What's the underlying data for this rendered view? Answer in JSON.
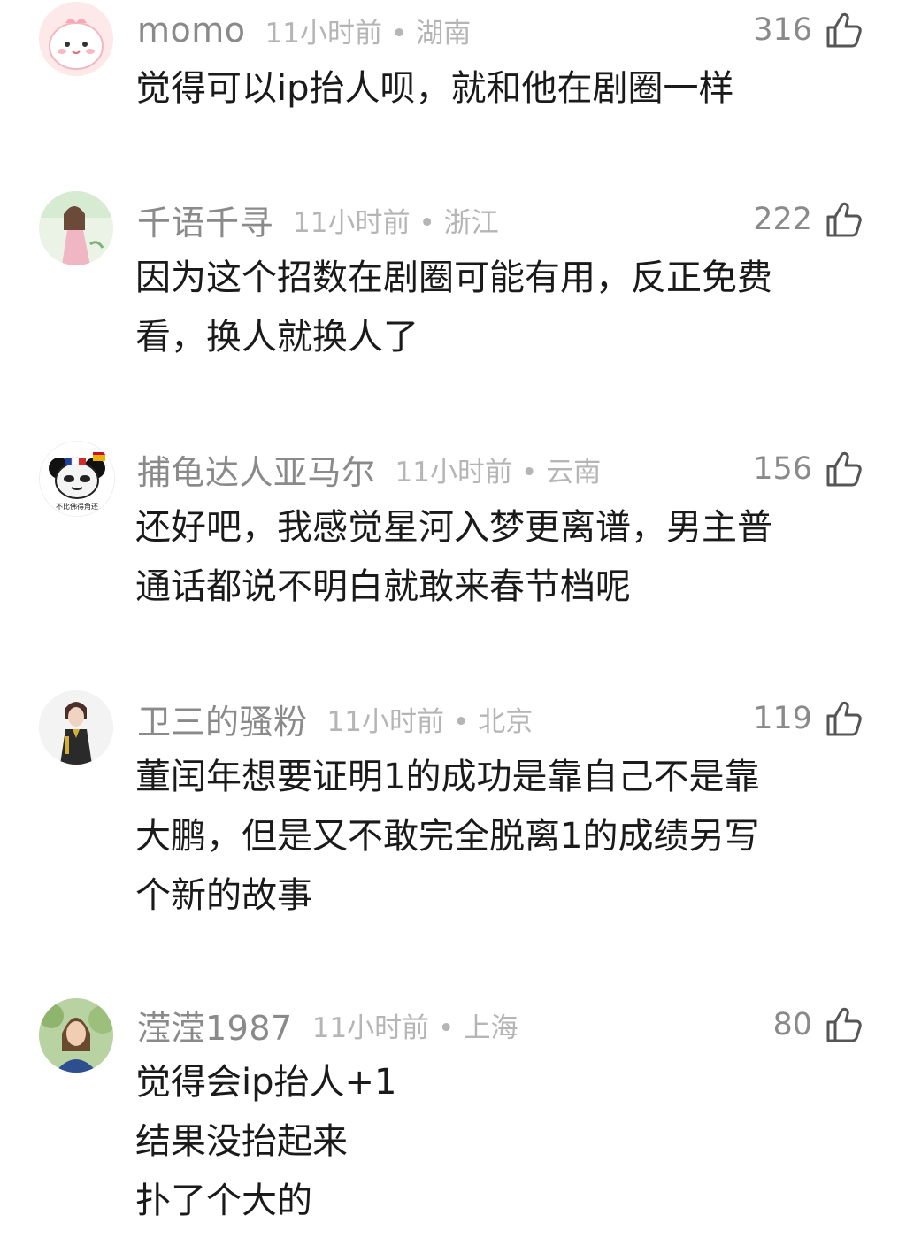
{
  "comments": [
    {
      "username": "momo",
      "time": "11小时前",
      "location": "湖南",
      "likes": "316",
      "text": "觉得可以ip抬人呗，就和他在剧圈一样",
      "avatar_icon": "pink-cartoon-avatar"
    },
    {
      "username": "千语千寻",
      "time": "11小时前",
      "location": "浙江",
      "likes": "222",
      "text": "因为这个招数在剧圈可能有用，反正免费\n看，换人就换人了",
      "avatar_icon": "illustrated-girl-avatar"
    },
    {
      "username": "捕龟达人亚马尔",
      "time": "11小时前",
      "location": "云南",
      "likes": "156",
      "text": "还好吧，我感觉星河入梦更离谱，男主普\n通话都说不明白就敢来春节档呢",
      "avatar_icon": "panda-meme-avatar",
      "avatar_caption": "不比佛得角还"
    },
    {
      "username": "卫三的骚粉",
      "time": "11小时前",
      "location": "北京",
      "likes": "119",
      "text": "董闰年想要证明1的成功是靠自己不是靠\n大鹏，但是又不敢完全脱离1的成绩另写\n个新的故事",
      "avatar_icon": "anime-man-avatar"
    },
    {
      "username": "滢滢1987",
      "time": "11小时前",
      "location": "上海",
      "likes": "80",
      "text": "觉得会ip抬人+1\n结果没抬起来\n扑了个大的",
      "avatar_icon": "woman-photo-avatar"
    }
  ]
}
